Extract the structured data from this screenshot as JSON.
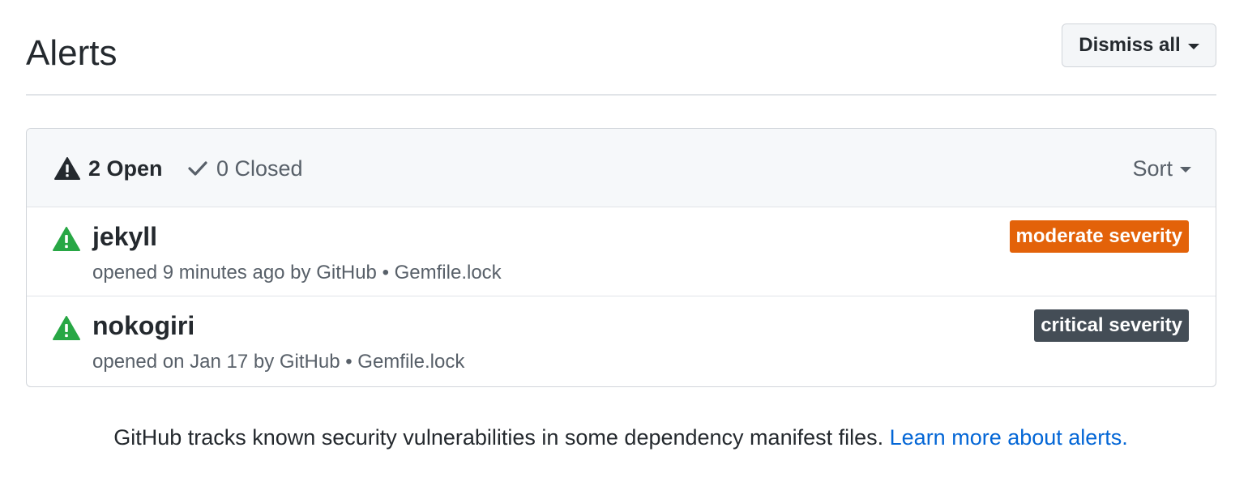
{
  "header": {
    "title": "Alerts",
    "dismiss_all_label": "Dismiss all"
  },
  "filters": {
    "open_label": "2 Open",
    "closed_label": "0 Closed",
    "sort_label": "Sort"
  },
  "alerts": [
    {
      "name": "jekyll",
      "meta": "opened 9 minutes ago by GitHub • Gemfile.lock",
      "severity": "moderate severity",
      "severity_color": "#e36209"
    },
    {
      "name": "nokogiri",
      "meta": "opened on Jan 17 by GitHub • Gemfile.lock",
      "severity": "critical severity",
      "severity_color": "#444d56"
    }
  ],
  "footer": {
    "text": "GitHub tracks known security vulnerabilities in some dependency manifest files.",
    "link_label": "Learn more about alerts."
  },
  "colors": {
    "alert_icon_green": "#28a745",
    "link_blue": "#0366d6"
  },
  "icons": {
    "open": "alert-icon",
    "closed": "check-icon",
    "row": "alert-icon"
  }
}
